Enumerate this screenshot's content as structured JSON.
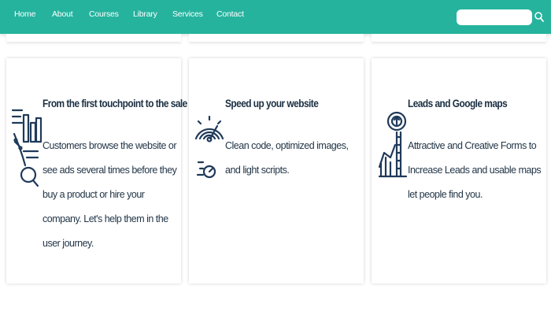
{
  "nav": {
    "items": [
      {
        "label": "Home"
      },
      {
        "label": "About"
      },
      {
        "label": "Courses"
      },
      {
        "label": "Library"
      },
      {
        "label": "Services"
      },
      {
        "label": "Contact"
      }
    ],
    "search": {
      "value": "",
      "placeholder": ""
    },
    "search_icon": "search-icon"
  },
  "cards": [
    {
      "icon": "customer-journey-icon",
      "title": "From the first touchpoint to the sale",
      "text": "Customers browse the website or see ads several times before they buy a product or hire your company. Let's help them in the user journey."
    },
    {
      "icon": "speedometer-icon",
      "title": "Speed up your website",
      "text": "Clean code, optimized images, and light scripts."
    },
    {
      "icon": "growth-chart-icon",
      "title": "Leads and Google maps",
      "text": "Attractive and Creative Forms to Increase Leads and usable maps let people find you."
    }
  ],
  "colors": {
    "nav_bg": "#25b39e",
    "icon": "#1f3a5a",
    "text": "#233648"
  }
}
